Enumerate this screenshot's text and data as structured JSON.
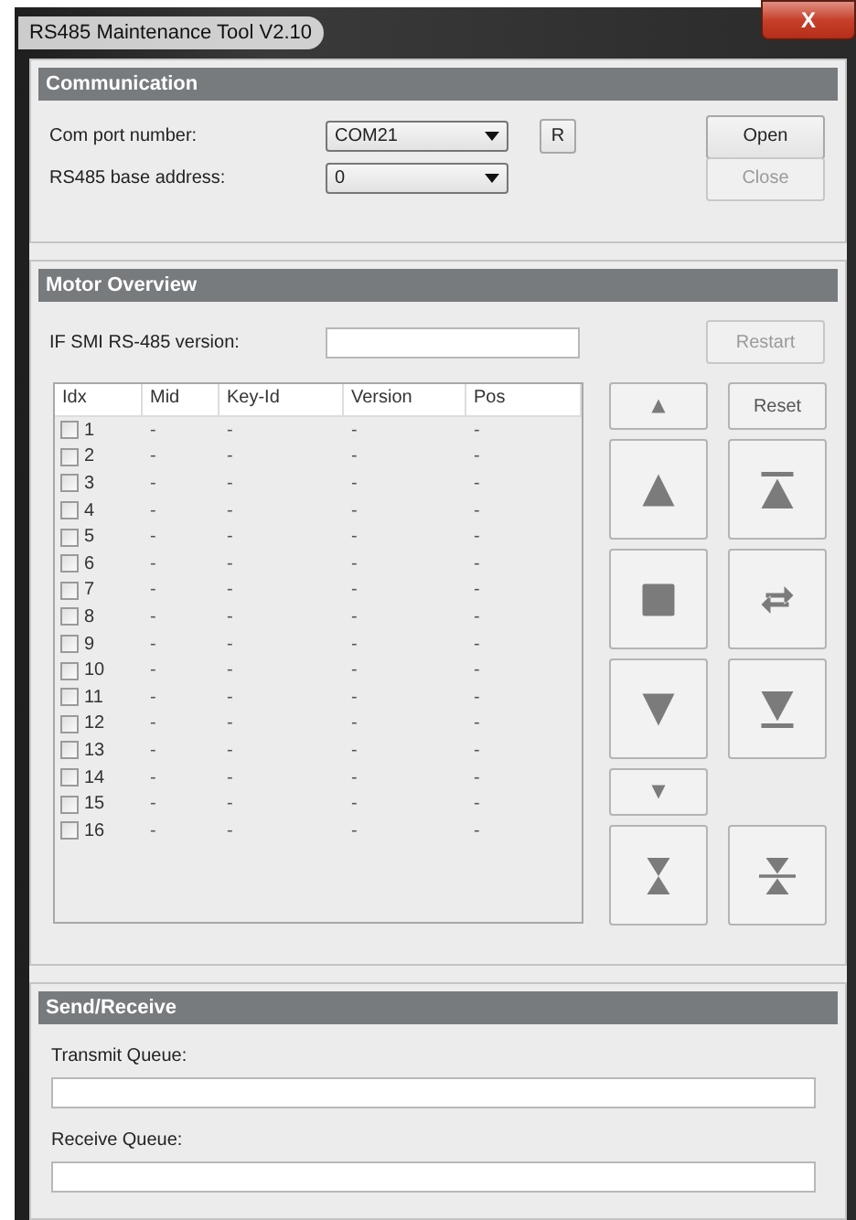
{
  "window": {
    "title": "RS485 Maintenance Tool V2.10",
    "close_button": "X"
  },
  "communication": {
    "title": "Communication",
    "fields": [
      {
        "label": "Com port number:",
        "value": "COM21"
      },
      {
        "label": "RS485 base address:",
        "value": "0"
      }
    ],
    "refresh_button": "R",
    "buttons": [
      {
        "label": "Open",
        "disabled": false
      },
      {
        "label": "Close",
        "disabled": true
      }
    ]
  },
  "motor_overview": {
    "title": "Motor Overview",
    "version_label": "IF SMI RS-485 version:",
    "restart_button": {
      "label": "Restart",
      "disabled": true
    },
    "table": {
      "columns": [
        "Idx",
        "Mid",
        "Key-Id",
        "Version",
        "Pos"
      ],
      "rows": [
        {
          "cells": [
            "1",
            "-",
            "-",
            "-",
            "-"
          ],
          "checked": false
        },
        {
          "cells": [
            "2",
            "-",
            "-",
            "-",
            "-"
          ],
          "checked": false
        },
        {
          "cells": [
            "3",
            "-",
            "-",
            "-",
            "-"
          ],
          "checked": false
        },
        {
          "cells": [
            "4",
            "-",
            "-",
            "-",
            "-"
          ],
          "checked": false
        },
        {
          "cells": [
            "5",
            "-",
            "-",
            "-",
            "-"
          ],
          "checked": false
        },
        {
          "cells": [
            "6",
            "-",
            "-",
            "-",
            "-"
          ],
          "checked": false
        },
        {
          "cells": [
            "7",
            "-",
            "-",
            "-",
            "-"
          ],
          "checked": false
        },
        {
          "cells": [
            "8",
            "-",
            "-",
            "-",
            "-"
          ],
          "checked": false
        },
        {
          "cells": [
            "9",
            "-",
            "-",
            "-",
            "-"
          ],
          "checked": false
        },
        {
          "cells": [
            "10",
            "-",
            "-",
            "-",
            "-"
          ],
          "checked": false
        },
        {
          "cells": [
            "11",
            "-",
            "-",
            "-",
            "-"
          ],
          "checked": false
        },
        {
          "cells": [
            "12",
            "-",
            "-",
            "-",
            "-"
          ],
          "checked": false
        },
        {
          "cells": [
            "13",
            "-",
            "-",
            "-",
            "-"
          ],
          "checked": false
        },
        {
          "cells": [
            "14",
            "-",
            "-",
            "-",
            "-"
          ],
          "checked": false
        },
        {
          "cells": [
            "15",
            "-",
            "-",
            "-",
            "-"
          ],
          "checked": false
        },
        {
          "cells": [
            "16",
            "-",
            "-",
            "-",
            "-"
          ],
          "checked": false
        }
      ]
    },
    "controls": [
      {
        "kind": "step-up"
      },
      {
        "kind": "text",
        "label": "Reset"
      },
      {
        "kind": "up"
      },
      {
        "kind": "top"
      },
      {
        "kind": "stop"
      },
      {
        "kind": "swap"
      },
      {
        "kind": "down"
      },
      {
        "kind": "bottom"
      },
      {
        "kind": "step-down"
      },
      {
        "kind": "pinch"
      },
      {
        "kind": "center"
      }
    ]
  },
  "send_receive": {
    "title": "Send/Receive",
    "queues": [
      {
        "label": "Transmit Queue:"
      },
      {
        "label": "Receive Queue:"
      }
    ]
  }
}
